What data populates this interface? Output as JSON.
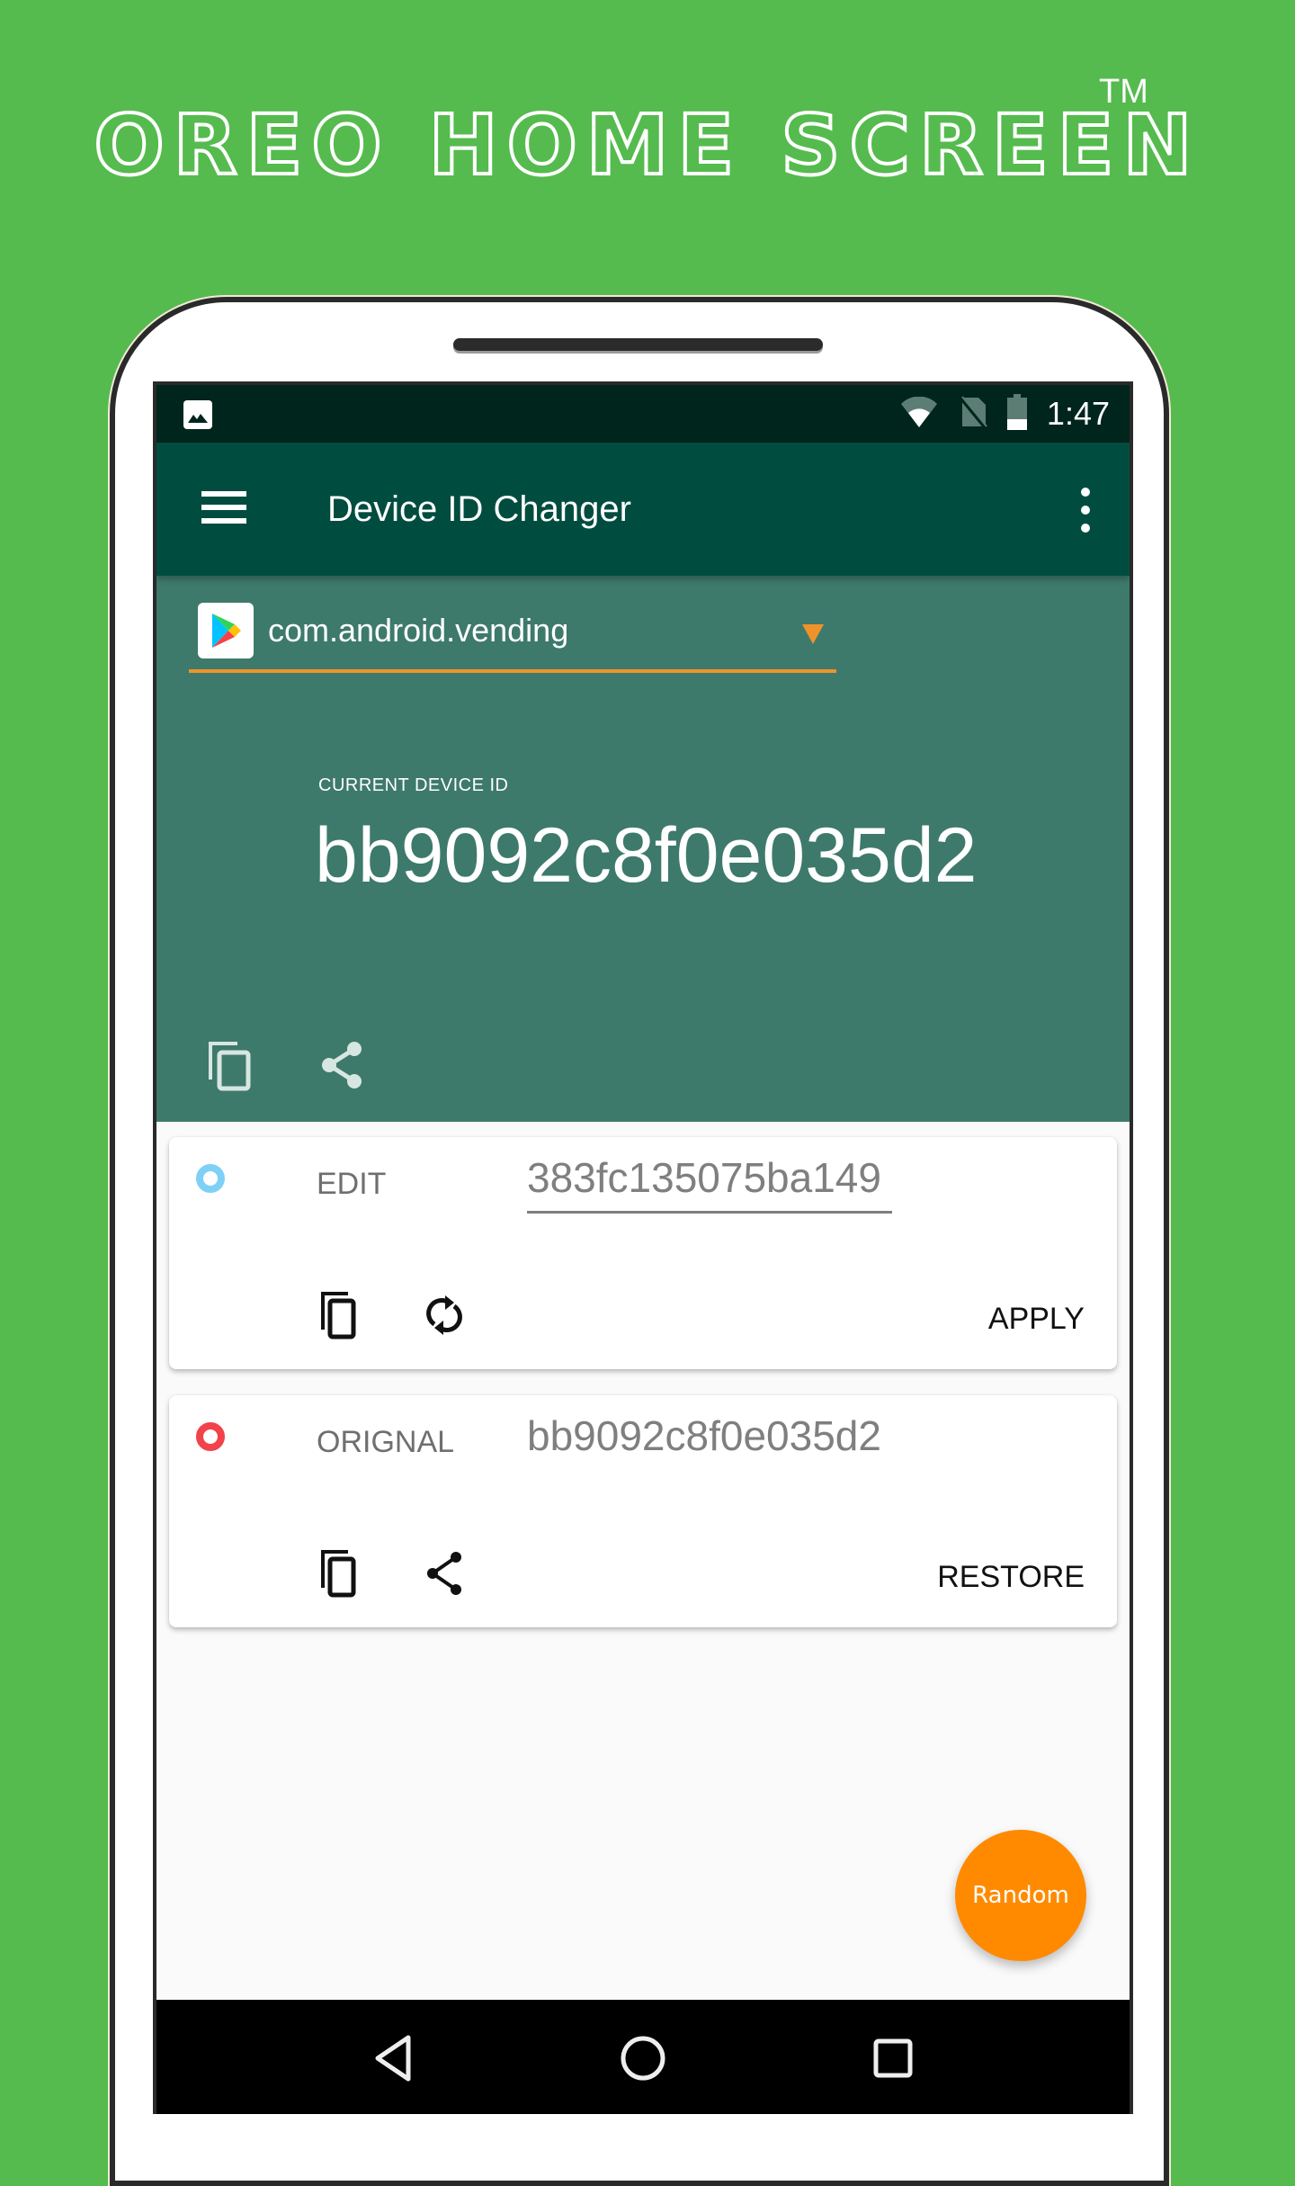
{
  "promo": {
    "title": "OREO HOME SCREEN",
    "trademark": "TM"
  },
  "status_bar": {
    "time": "1:47",
    "icons": [
      "image-notification-icon",
      "wifi-icon",
      "no-sim-icon",
      "battery-icon"
    ]
  },
  "app_bar": {
    "title": "Device ID Changer",
    "menu_icon": "hamburger-menu-icon",
    "overflow_icon": "more-vert-icon"
  },
  "app_selector": {
    "selected_package": "com.android.vending",
    "app_icon": "google-play-icon"
  },
  "current_device": {
    "label": "CURRENT DEVICE ID",
    "value": "bb9092c8f0e035d2",
    "actions": [
      "copy-icon",
      "share-icon"
    ]
  },
  "edit_card": {
    "label": "EDIT",
    "value": "383fc135075ba149",
    "radio_color": "#7fd0f7",
    "actions": [
      "copy-icon",
      "refresh-icon"
    ],
    "action_button": "APPLY"
  },
  "original_card": {
    "label": "ORIGNAL",
    "value": "bb9092c8f0e035d2",
    "radio_color": "#f2424a",
    "actions": [
      "copy-icon",
      "share-icon"
    ],
    "action_button": "RESTORE"
  },
  "fab": {
    "label": "Random",
    "color": "#ff8a00"
  },
  "nav_bar": {
    "buttons": [
      "back",
      "home",
      "recents"
    ]
  },
  "colors": {
    "background": "#55bb4e",
    "status_bar": "#00251d",
    "app_bar": "#004d40",
    "banner": "#3d7a6b",
    "accent": "#f0922b"
  }
}
